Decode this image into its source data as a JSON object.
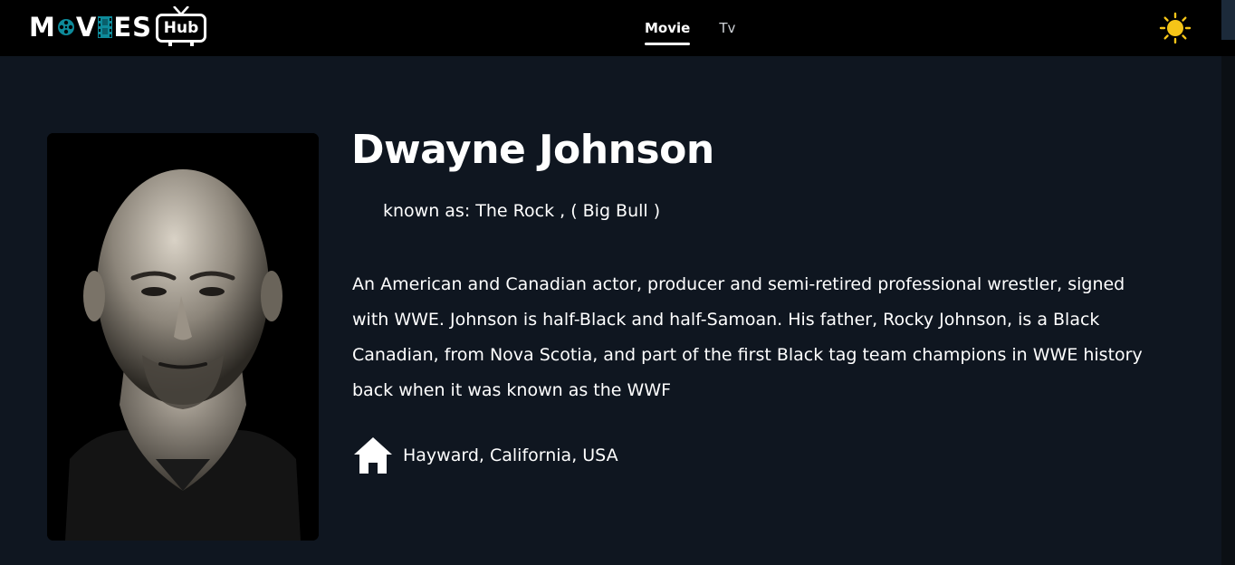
{
  "header": {
    "logo": {
      "text_left": "M",
      "text_mid": "V",
      "text_right": "ES",
      "badge": "Hub"
    },
    "nav": [
      {
        "label": "Movie",
        "active": true
      },
      {
        "label": "Tv",
        "active": false
      }
    ],
    "theme_icon": "sun-icon"
  },
  "person": {
    "name": "Dwayne Johnson",
    "known_as": "known as: The Rock , ( Big Bull )",
    "biography": "An American and Canadian actor, producer and semi-retired professional wrestler, signed with WWE. Johnson is half-Black and half-Samoan. His father, Rocky Johnson, is a Black Canadian, from Nova Scotia, and part of the first Black tag team champions in WWE history back when it was known as the WWF",
    "birthplace": "Hayward, California, USA",
    "birthplace_icon": "home-icon"
  },
  "colors": {
    "page_bg": "#0f1620",
    "header_bg": "#000000",
    "sun": "#f5c518",
    "logo_reel": "#0e8b9b",
    "text": "#ffffff"
  }
}
